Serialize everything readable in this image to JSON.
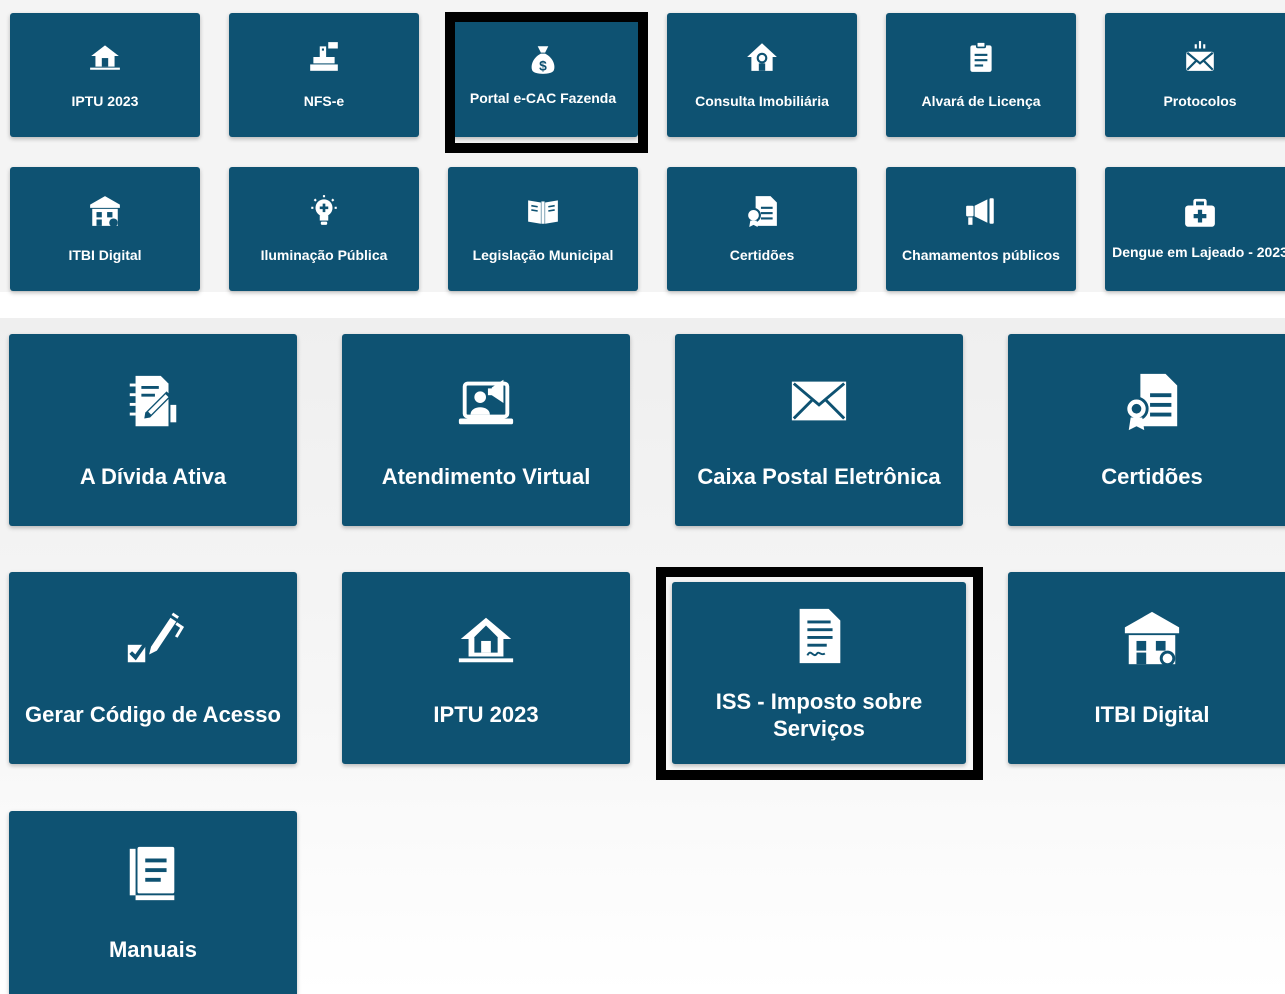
{
  "top_grid": {
    "tiles": [
      {
        "label": "IPTU 2023",
        "icon": "house-icon"
      },
      {
        "label": "NFS-e",
        "icon": "cash-register-icon"
      },
      {
        "label": "Portal e-CAC Fazenda",
        "icon": "money-bag-icon"
      },
      {
        "label": "Consulta Imobiliária",
        "icon": "home-search-icon"
      },
      {
        "label": "Alvará de Licença",
        "icon": "clipboard-icon"
      },
      {
        "label": "Protocolos",
        "icon": "envelope-icon"
      },
      {
        "label": "ITBI Digital",
        "icon": "building-icon"
      },
      {
        "label": "Iluminação Pública",
        "icon": "lightbulb-icon"
      },
      {
        "label": "Legislação Municipal",
        "icon": "open-book-icon"
      },
      {
        "label": "Certidões",
        "icon": "certificate-icon"
      },
      {
        "label": "Chamamentos públicos",
        "icon": "megaphone-icon"
      },
      {
        "label": "Dengue em Lajeado - 2023",
        "icon": "first-aid-kit-icon"
      }
    ]
  },
  "bottom_grid": {
    "tiles": [
      {
        "label": "A Dívida Ativa",
        "icon": "document-sign-icon"
      },
      {
        "label": "Atendimento Virtual",
        "icon": "virtual-support-icon"
      },
      {
        "label": "Caixa Postal Eletrônica",
        "icon": "envelope-icon"
      },
      {
        "label": "Certidões",
        "icon": "certificate-icon"
      },
      {
        "label": "Gerar Código de Acesso",
        "icon": "pen-check-icon"
      },
      {
        "label": "IPTU 2023",
        "icon": "house-icon"
      },
      {
        "label": "ISS - Imposto sobre Serviços",
        "icon": "signed-document-icon"
      },
      {
        "label": "ITBI Digital",
        "icon": "building-icon"
      },
      {
        "label": "Manuais",
        "icon": "manual-book-icon"
      }
    ]
  },
  "colors": {
    "tile_bg": "#0e5272",
    "tile_text": "#ffffff",
    "highlight_border": "#000000"
  }
}
